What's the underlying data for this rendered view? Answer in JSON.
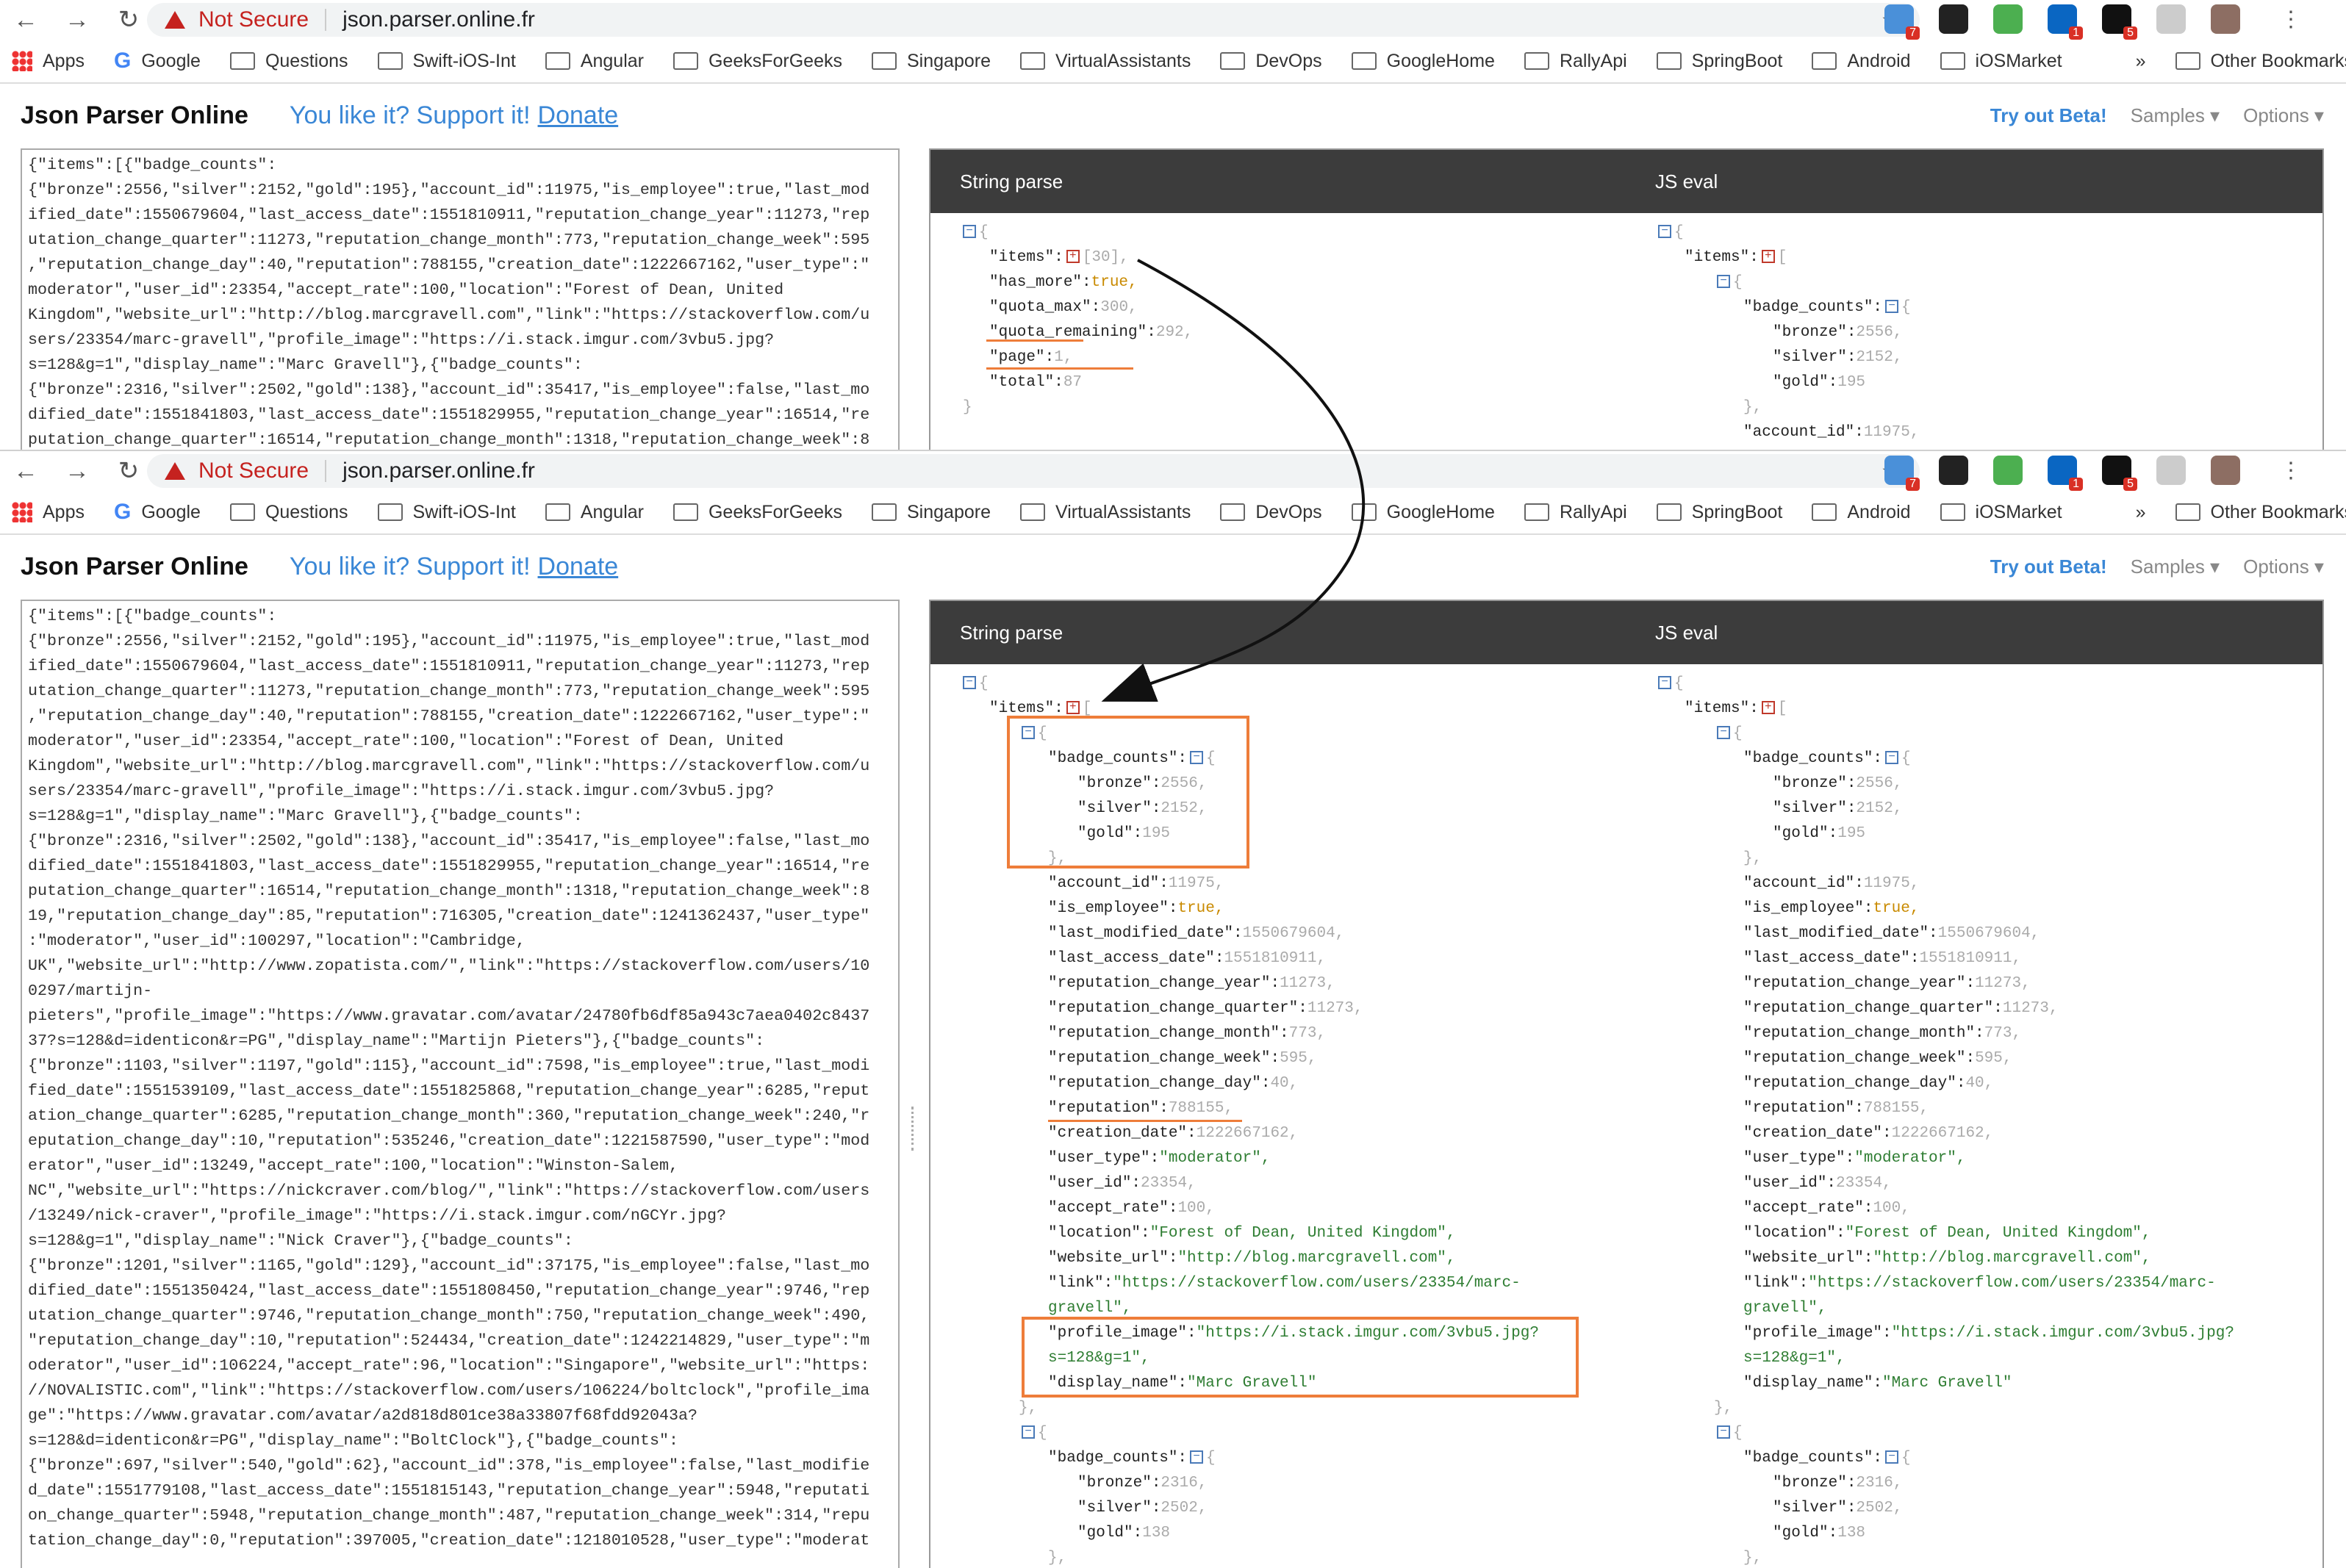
{
  "browser": {
    "nav": {
      "back": "←",
      "forward": "→",
      "reload": "↻"
    },
    "not_secure": "Not Secure",
    "url": "json.parser.online.fr",
    "star": "☆",
    "menu": "⋮",
    "extensions": [
      {
        "icon": "translate-ext-icon",
        "color": "#4a90d9",
        "badge": "7"
      },
      {
        "icon": "ghost-ext-icon",
        "color": "#222",
        "badge": ""
      },
      {
        "icon": "download-ext-icon",
        "color": "#4caf50",
        "badge": ""
      },
      {
        "icon": "linkedin-ext-icon",
        "color": "#0a66c2",
        "badge": "1"
      },
      {
        "icon": "amazon-ext-icon",
        "color": "#111",
        "badge": "5"
      },
      {
        "icon": "circle-ext-icon",
        "color": "#ccc",
        "badge": ""
      },
      {
        "icon": "profile-avatar-icon",
        "color": "#8d6e63",
        "badge": ""
      }
    ],
    "bookmarks": [
      "Questions",
      "Swift-iOS-Int",
      "Angular",
      "GeeksForGeeks",
      "Singapore",
      "VirtualAssistants",
      "DevOps",
      "GoogleHome",
      "RallyApi",
      "SpringBoot",
      "Android",
      "iOSMarket"
    ],
    "apps": "Apps",
    "google": "Google",
    "more": "»",
    "other": "Other Bookmarks"
  },
  "header": {
    "title": "Json Parser Online",
    "support": "You like it? Support it!",
    "donate": "Donate",
    "beta": "Try out Beta!",
    "samples": "Samples ▾",
    "options": "Options ▾"
  },
  "panels": {
    "string_parse": "String parse",
    "js_eval": "JS eval"
  },
  "raw_text": "{\"items\":[{\"badge_counts\":\n{\"bronze\":2556,\"silver\":2152,\"gold\":195},\"account_id\":11975,\"is_employee\":true,\"last_mod\nified_date\":1550679604,\"last_access_date\":1551810911,\"reputation_change_year\":11273,\"rep\nutation_change_quarter\":11273,\"reputation_change_month\":773,\"reputation_change_week\":595\n,\"reputation_change_day\":40,\"reputation\":788155,\"creation_date\":1222667162,\"user_type\":\"\nmoderator\",\"user_id\":23354,\"accept_rate\":100,\"location\":\"Forest of Dean, United\nKingdom\",\"website_url\":\"http://blog.marcgravell.com\",\"link\":\"https://stackoverflow.com/u\nsers/23354/marc-gravell\",\"profile_image\":\"https://i.stack.imgur.com/3vbu5.jpg?\ns=128&g=1\",\"display_name\":\"Marc Gravell\"},{\"badge_counts\":\n{\"bronze\":2316,\"silver\":2502,\"gold\":138},\"account_id\":35417,\"is_employee\":false,\"last_mo\ndified_date\":1551841803,\"last_access_date\":1551829955,\"reputation_change_year\":16514,\"re\nputation_change_quarter\":16514,\"reputation_change_month\":1318,\"reputation_change_week\":8\n19,\"reputation_change_day\":85,\"reputation\":716305,\"creation_date\":1241362437,\"user_type\"\n:\"moderator\",\"user_id\":100297,\"location\":\"Cambridge,\nUK\",\"website_url\":\"http://www.zopatista.com/\",\"link\":\"https://stackoverflow.com/users/10\n0297/martijn-\npieters\",\"profile_image\":\"https://www.gravatar.com/avatar/24780fb6df85a943c7aea0402c8437\n37?s=128&d=identicon&r=PG\",\"display_name\":\"Martijn Pieters\"},{\"badge_counts\":\n{\"bronze\":1103,\"silver\":1197,\"gold\":115},\"account_id\":7598,\"is_employee\":true,\"last_modi\nfied_date\":1551539109,\"last_access_date\":1551825868,\"reputation_change_year\":6285,\"reput\nation_change_quarter\":6285,\"reputation_change_month\":360,\"reputation_change_week\":240,\"r\neputation_change_day\":10,\"reputation\":535246,\"creation_date\":1221587590,\"user_type\":\"mod\nerator\",\"user_id\":13249,\"accept_rate\":100,\"location\":\"Winston-Salem,\nNC\",\"website_url\":\"https://nickcraver.com/blog/\",\"link\":\"https://stackoverflow.com/users\n/13249/nick-craver\",\"profile_image\":\"https://i.stack.imgur.com/nGCYr.jpg?\ns=128&g=1\",\"display_name\":\"Nick Craver\"},{\"badge_counts\":\n{\"bronze\":1201,\"silver\":1165,\"gold\":129},\"account_id\":37175,\"is_employee\":false,\"last_mo\ndified_date\":1551350424,\"last_access_date\":1551808450,\"reputation_change_year\":9746,\"rep\nutation_change_quarter\":9746,\"reputation_change_month\":750,\"reputation_change_week\":490,\n\"reputation_change_day\":10,\"reputation\":524434,\"creation_date\":1242214829,\"user_type\":\"m\noderator\",\"user_id\":106224,\"accept_rate\":96,\"location\":\"Singapore\",\"website_url\":\"https:\n//NOVALISTIC.com\",\"link\":\"https://stackoverflow.com/users/106224/boltclock\",\"profile_ima\nge\":\"https://www.gravatar.com/avatar/a2d818d801ce38a33807f68fdd92043a?\ns=128&d=identicon&r=PG\",\"display_name\":\"BoltClock\"},{\"badge_counts\":\n{\"bronze\":697,\"silver\":540,\"gold\":62},\"account_id\":378,\"is_employee\":false,\"last_modifie\nd_date\":1551779108,\"last_access_date\":1551815143,\"reputation_change_year\":5948,\"reputati\non_change_quarter\":5948,\"reputation_change_month\":487,\"reputation_change_week\":314,\"repu\ntation_change_day\":0,\"reputation\":397005,\"creation_date\":1218010528,\"user_type\":\"moderat",
  "top_tree": {
    "items": "\"items\":",
    "items_count": "[30],",
    "rows": [
      {
        "k": "\"has_more\":",
        "v": "true,",
        "t": "b"
      },
      {
        "k": "\"quota_max\":",
        "v": "300,",
        "t": "n"
      },
      {
        "k": "\"quota_remaining\":",
        "v": "292,",
        "t": "n"
      },
      {
        "k": "\"page\":",
        "v": "1,",
        "t": "n"
      },
      {
        "k": "\"total\":",
        "v": "87",
        "t": "n"
      }
    ]
  },
  "js_top": {
    "items": "\"items\":",
    "badge": "\"badge_counts\":",
    "bronze": "\"bronze\":",
    "bronze_v": "2556,",
    "silver": "\"silver\":",
    "silver_v": "2152,",
    "gold": "\"gold\":",
    "gold_v": "195",
    "close": "},",
    "acc": "\"account_id\":",
    "acc_v": "11975,"
  },
  "tree": {
    "items": "\"items\":",
    "badge_counts": "\"badge_counts\":",
    "first": {
      "bronze": "2556,",
      "silver": "2152,",
      "gold": "195",
      "fields": [
        {
          "k": "\"account_id\":",
          "v": "11975,",
          "t": "n"
        },
        {
          "k": "\"is_employee\":",
          "v": "true,",
          "t": "b"
        },
        {
          "k": "\"last_modified_date\":",
          "v": "1550679604,",
          "t": "n"
        },
        {
          "k": "\"last_access_date\":",
          "v": "1551810911,",
          "t": "n"
        },
        {
          "k": "\"reputation_change_year\":",
          "v": "11273,",
          "t": "n"
        },
        {
          "k": "\"reputation_change_quarter\":",
          "v": "11273,",
          "t": "n"
        },
        {
          "k": "\"reputation_change_month\":",
          "v": "773,",
          "t": "n"
        },
        {
          "k": "\"reputation_change_week\":",
          "v": "595,",
          "t": "n"
        },
        {
          "k": "\"reputation_change_day\":",
          "v": "40,",
          "t": "n"
        },
        {
          "k": "\"reputation\":",
          "v": "788155,",
          "t": "n"
        },
        {
          "k": "\"creation_date\":",
          "v": "1222667162,",
          "t": "n"
        },
        {
          "k": "\"user_type\":",
          "v": "\"moderator\",",
          "t": "s"
        },
        {
          "k": "\"user_id\":",
          "v": "23354,",
          "t": "n"
        },
        {
          "k": "\"accept_rate\":",
          "v": "100,",
          "t": "n"
        },
        {
          "k": "\"location\":",
          "v": "\"Forest of Dean, United Kingdom\",",
          "t": "s"
        },
        {
          "k": "\"website_url\":",
          "v": "\"http://blog.marcgravell.com\",",
          "t": "s"
        },
        {
          "k": "\"link\":",
          "v": "\"https://stackoverflow.com/users/23354/marc-",
          "t": "s"
        },
        {
          "k": "",
          "v": "gravell\",",
          "t": "s"
        },
        {
          "k": "\"profile_image\":",
          "v": "\"https://i.stack.imgur.com/3vbu5.jpg?",
          "t": "s"
        },
        {
          "k": "",
          "v": "s=128&g=1\",",
          "t": "s"
        },
        {
          "k": "\"display_name\":",
          "v": "\"Marc Gravell\"",
          "t": "s"
        }
      ]
    },
    "second": {
      "bronze": "2316,",
      "silver": "2502,",
      "gold": "138"
    }
  }
}
